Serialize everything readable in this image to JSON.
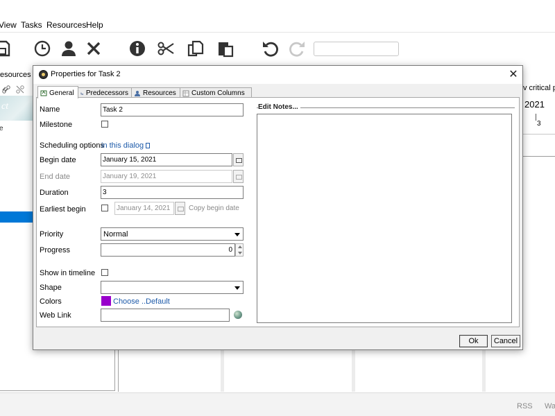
{
  "menu": {
    "view": "View",
    "tasks": "Tasks",
    "resources": "Resources",
    "help": "Help"
  },
  "toolbar": {
    "icons": [
      "save-icon",
      "clock-icon",
      "user-icon",
      "delete-icon",
      "info-icon",
      "cut-icon",
      "copy-icon",
      "paste-icon",
      "undo-icon",
      "redo-icon"
    ],
    "search_value": ""
  },
  "left_panel": {
    "tab_label": "esources Ch",
    "logo_text": "ct",
    "header_fragment": "e"
  },
  "right_panel": {
    "critical_path_label": "v critical pa",
    "year": "2021",
    "tick": "3"
  },
  "status_bar": {
    "rss": "RSS",
    "extra": "Wa"
  },
  "dialog": {
    "title": "Properties for Task 2",
    "tabs": [
      {
        "label": "General"
      },
      {
        "label": "Predecessors"
      },
      {
        "label": "Resources"
      },
      {
        "label": "Custom Columns"
      }
    ],
    "fields": {
      "name_label": "Name",
      "name_value": "Task 2",
      "milestone_label": "Milestone",
      "milestone_checked": false,
      "scheduling_label": "Scheduling options",
      "scheduling_link": "in this dialog",
      "begin_label": "Begin date",
      "begin_value": "January 15, 2021",
      "end_label": "End date",
      "end_value": "January 19, 2021",
      "duration_label": "Duration",
      "duration_value": "3",
      "earliest_label": "Earliest begin",
      "earliest_checked": false,
      "earliest_value": "January 14, 2021",
      "copy_begin_label": "Copy begin date",
      "priority_label": "Priority",
      "priority_value": "Normal",
      "progress_label": "Progress",
      "progress_value": "0",
      "show_timeline_label": "Show in timeline",
      "show_timeline_checked": false,
      "shape_label": "Shape",
      "shape_value": "",
      "colors_label": "Colors",
      "color_swatch": "#9900cc",
      "choose_link": "Choose ...",
      "default_link": "Default",
      "weblink_label": "Web Link",
      "weblink_value": ""
    },
    "notes_legend": "Edit Notes...",
    "notes_value": "",
    "ok_label": "Ok",
    "cancel_label": "Cancel"
  }
}
